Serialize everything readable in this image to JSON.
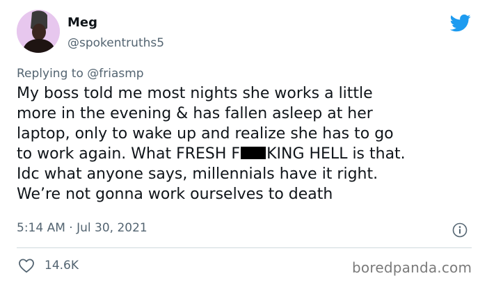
{
  "author": {
    "name": "Meg",
    "handle": "@spokentruths5",
    "avatar_bg": "#e7c7ee"
  },
  "reply": {
    "prefix": "Replying to",
    "mention": "@friasmp"
  },
  "tweet": {
    "line1": "My boss told me most nights she works a little",
    "line2": "more in the evening & has fallen asleep at her",
    "line3": "laptop, only to wake up and realize she has to go",
    "line4_pre": "to work again. What FRESH F",
    "line4_post": "KING HELL is that.",
    "line5": "Idc what anyone says, millennials have it right.",
    "line6": "We’re not gonna work ourselves to death"
  },
  "meta": {
    "timestamp": "5:14 AM · Jul 30, 2021"
  },
  "actions": {
    "likes": "14.6K"
  },
  "watermark": "boredpanda.com",
  "icons": {
    "brand": "twitter-bird-icon",
    "info": "info-icon",
    "like": "heart-icon"
  },
  "colors": {
    "twitter_blue": "#1d9bf0",
    "secondary_text": "#536471"
  }
}
